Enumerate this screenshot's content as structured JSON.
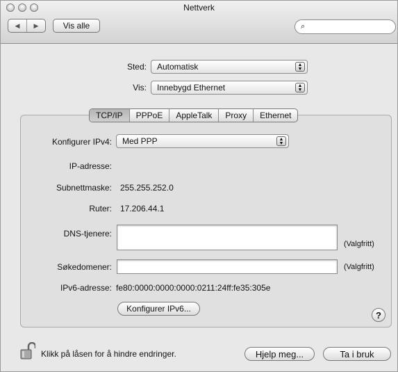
{
  "window": {
    "title": "Nettverk"
  },
  "toolbar": {
    "show_all_label": "Vis alle",
    "search_icon": "⌕",
    "nav_back": "◀",
    "nav_forward": "▶"
  },
  "location": {
    "label": "Sted:",
    "value": "Automatisk"
  },
  "show": {
    "label": "Vis:",
    "value": "Innebygd Ethernet"
  },
  "tabs": [
    {
      "label": "TCP/IP"
    },
    {
      "label": "PPPoE"
    },
    {
      "label": "AppleTalk"
    },
    {
      "label": "Proxy"
    },
    {
      "label": "Ethernet"
    }
  ],
  "ipv4": {
    "configure_label": "Konfigurer IPv4:",
    "configure_value": "Med PPP",
    "ip_label": "IP-adresse:",
    "ip_value": "",
    "subnet_label": "Subnettmaske:",
    "subnet_value": "255.255.252.0",
    "router_label": "Ruter:",
    "router_value": "17.206.44.1",
    "dns_label": "DNS-tjenere:",
    "dns_value": "",
    "dns_optional": "(Valgfritt)",
    "search_label": "Søkedomener:",
    "search_value": "",
    "search_optional": "(Valgfritt)",
    "ipv6_label": "IPv6-adresse:",
    "ipv6_value": "fe80:0000:0000:0000:0211:24ff:fe35:305e",
    "configure_ipv6_label": "Konfigurer IPv6...",
    "help_label": "?"
  },
  "footer": {
    "lock_text": "Klikk på låsen for å hindre endringer.",
    "help_button": "Hjelp meg...",
    "apply_button": "Ta i bruk"
  },
  "colors": {
    "window_bg": "#e8e8e8",
    "panel_bg": "#e0e0e0",
    "active_tab": "#b5b5b5"
  }
}
